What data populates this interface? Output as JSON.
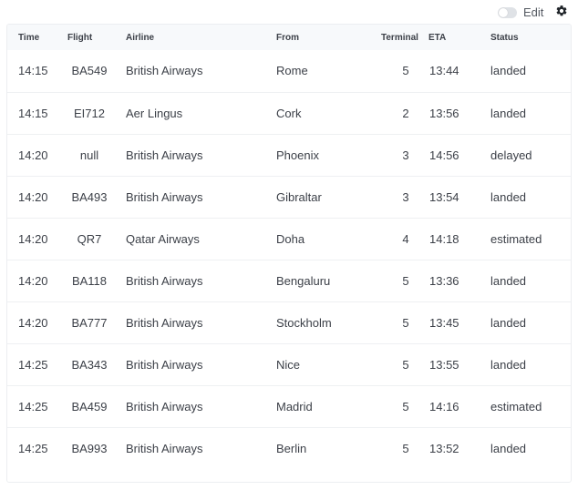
{
  "toolbar": {
    "edit_label": "Edit",
    "edit_enabled": false,
    "settings_icon": "gear-icon"
  },
  "table": {
    "columns": [
      "Time",
      "Flight",
      "Airline",
      "From",
      "Terminal",
      "ETA",
      "Status"
    ],
    "rows": [
      {
        "time": "14:15",
        "flight": "BA549",
        "airline": "British Airways",
        "from": "Rome",
        "terminal": "5",
        "eta": "13:44",
        "status": "landed"
      },
      {
        "time": "14:15",
        "flight": "EI712",
        "airline": "Aer Lingus",
        "from": "Cork",
        "terminal": "2",
        "eta": "13:56",
        "status": "landed"
      },
      {
        "time": "14:20",
        "flight": "null",
        "airline": "British Airways",
        "from": "Phoenix",
        "terminal": "3",
        "eta": "14:56",
        "status": "delayed"
      },
      {
        "time": "14:20",
        "flight": "BA493",
        "airline": "British Airways",
        "from": "Gibraltar",
        "terminal": "3",
        "eta": "13:54",
        "status": "landed"
      },
      {
        "time": "14:20",
        "flight": "QR7",
        "airline": "Qatar Airways",
        "from": "Doha",
        "terminal": "4",
        "eta": "14:18",
        "status": "estimated"
      },
      {
        "time": "14:20",
        "flight": "BA118",
        "airline": "British Airways",
        "from": "Bengaluru",
        "terminal": "5",
        "eta": "13:36",
        "status": "landed"
      },
      {
        "time": "14:20",
        "flight": "BA777",
        "airline": "British Airways",
        "from": "Stockholm",
        "terminal": "5",
        "eta": "13:45",
        "status": "landed"
      },
      {
        "time": "14:25",
        "flight": "BA343",
        "airline": "British Airways",
        "from": "Nice",
        "terminal": "5",
        "eta": "13:55",
        "status": "landed"
      },
      {
        "time": "14:25",
        "flight": "BA459",
        "airline": "British Airways",
        "from": "Madrid",
        "terminal": "5",
        "eta": "14:16",
        "status": "estimated"
      },
      {
        "time": "14:25",
        "flight": "BA993",
        "airline": "British Airways",
        "from": "Berlin",
        "terminal": "5",
        "eta": "13:52",
        "status": "landed"
      }
    ]
  }
}
